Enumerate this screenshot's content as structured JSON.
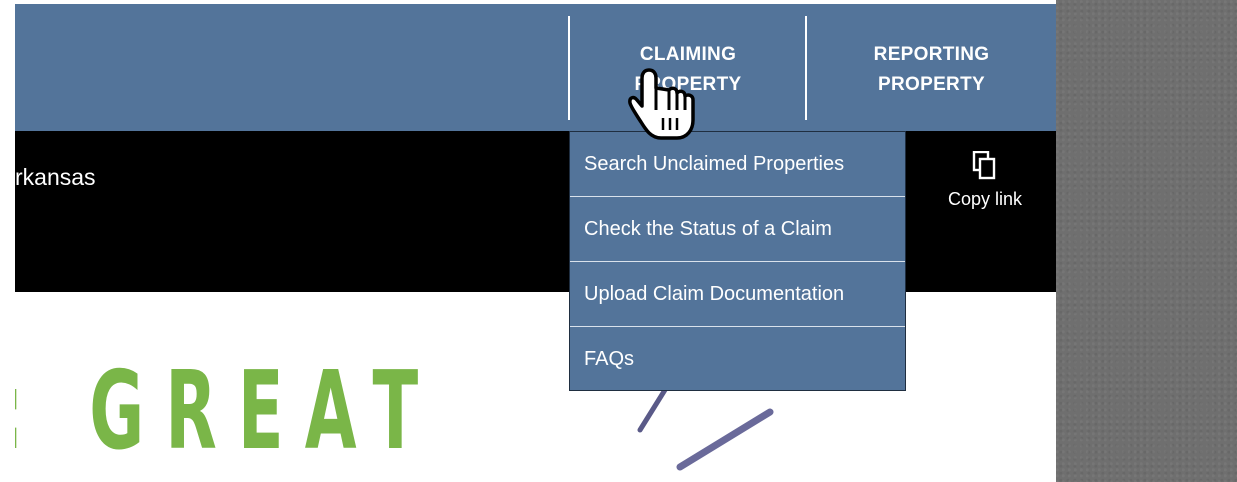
{
  "nav": {
    "items": [
      {
        "line1": "CLAIMING",
        "line2": "PROPERTY"
      },
      {
        "line1": "REPORTING",
        "line2": "PROPERTY"
      }
    ]
  },
  "video": {
    "title": "rkansas",
    "copy_link_label": "Copy link",
    "copy_icon": "copy-icon"
  },
  "dropdown": {
    "items": [
      "Search Unclaimed Properties",
      "Check the Status of a Claim",
      "Upload Claim Documentation",
      "FAQs"
    ]
  },
  "banner": {
    "text": ": GREAT"
  },
  "cursor": {
    "icon": "hand-pointer-icon"
  },
  "colors": {
    "nav_bg": "#53749a",
    "accent_green": "#7ab648",
    "black_bar": "#000000",
    "side_gray": "#6f6f6f"
  }
}
